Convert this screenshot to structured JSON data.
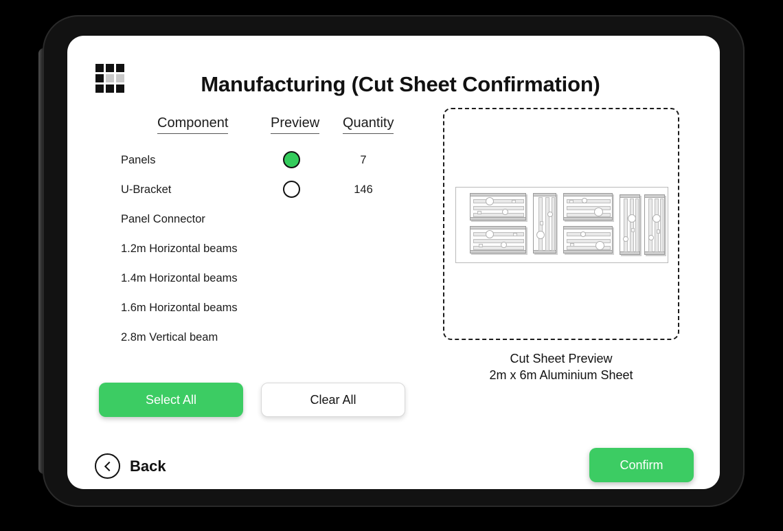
{
  "app": {
    "title": "Manufacturing (Cut Sheet Confirmation)",
    "menu_icon": "grid-icon",
    "accent_color": "#3ccc63",
    "selected_color": "#34cc5c"
  },
  "table": {
    "headers": {
      "component": "Component",
      "preview": "Preview",
      "quantity": "Quantity"
    },
    "rows": [
      {
        "name": "Panels",
        "quantity": "7",
        "selected": true,
        "has_preview": true
      },
      {
        "name": "U-Bracket",
        "quantity": "146",
        "selected": false,
        "has_preview": true
      },
      {
        "name": "Panel Connector",
        "quantity": "",
        "selected": false,
        "has_preview": false
      },
      {
        "name": "1.2m Horizontal beams",
        "quantity": "",
        "selected": false,
        "has_preview": false
      },
      {
        "name": "1.4m Horizontal beams",
        "quantity": "",
        "selected": false,
        "has_preview": false
      },
      {
        "name": "1.6m Horizontal beams",
        "quantity": "",
        "selected": false,
        "has_preview": false
      },
      {
        "name": "2.8m Vertical beam",
        "quantity": "",
        "selected": false,
        "has_preview": false
      }
    ]
  },
  "actions": {
    "select_all": "Select All",
    "clear_all": "Clear All"
  },
  "preview": {
    "caption_line1": "Cut Sheet Preview",
    "caption_line2": "2m x 6m Aluminium Sheet",
    "sheet_width": "2m",
    "sheet_length": "6m",
    "material": "Aluminium"
  },
  "footer": {
    "back_label": "Back",
    "back_icon": "chevron-left-circle-icon",
    "confirm_label": "Confirm"
  }
}
